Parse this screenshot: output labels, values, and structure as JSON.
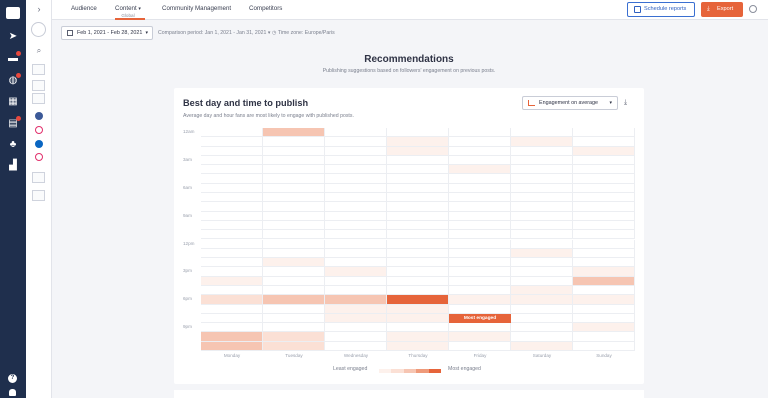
{
  "topnav": {
    "tabs": [
      {
        "label": "Audience"
      },
      {
        "label": "Content",
        "sub": "Global"
      },
      {
        "label": "Community Management"
      },
      {
        "label": "Competitors"
      }
    ],
    "schedule_label": "Schedule reports",
    "export_label": "Export"
  },
  "filters": {
    "date_range": "Feb 1, 2021 - Feb 28, 2021",
    "comparison": "Comparison period: Jan 1, 2021 - Jan 31, 2021",
    "timezone": "Time zone: Europe/Paris"
  },
  "header": {
    "title": "Recommendations",
    "subtitle": "Publishing suggestions based on followers' engagement on previous posts."
  },
  "card": {
    "title": "Best day and time to publish",
    "description": "Average day and hour fans are most likely to engage with published posts.",
    "select_label": "Engagement on average"
  },
  "heatmap": {
    "days": [
      "Monday",
      "Tuesday",
      "Wednesday",
      "Thursday",
      "Friday",
      "Saturday",
      "Sunday"
    ],
    "hour_labels": [
      "12am",
      "3am",
      "6am",
      "9am",
      "12pm",
      "3pm",
      "6pm",
      "9pm"
    ],
    "callout": "Most engaged",
    "legend_low": "Least engaged",
    "legend_high": "Most engaged",
    "colors": {
      "l1": "#fdf1ec",
      "l2": "#fbe0d5",
      "l3": "#f6c5b2",
      "l4": "#ef9a7a",
      "l5": "#e6643a"
    },
    "levels": [
      [
        0,
        3,
        0,
        0,
        0,
        0,
        0
      ],
      [
        0,
        0,
        0,
        1,
        0,
        1,
        0
      ],
      [
        0,
        0,
        0,
        1,
        0,
        0,
        1
      ],
      [
        0,
        0,
        0,
        0,
        0,
        0,
        0
      ],
      [
        0,
        0,
        0,
        0,
        1,
        0,
        0
      ],
      [
        0,
        0,
        0,
        0,
        0,
        0,
        0
      ],
      [
        0,
        0,
        0,
        0,
        0,
        0,
        0
      ],
      [
        0,
        0,
        0,
        0,
        0,
        0,
        0
      ],
      [
        0,
        0,
        0,
        0,
        0,
        0,
        0
      ],
      [
        0,
        0,
        0,
        0,
        0,
        0,
        0
      ],
      [
        0,
        0,
        0,
        0,
        0,
        0,
        0
      ],
      [
        0,
        0,
        0,
        0,
        0,
        0,
        0
      ],
      [
        0,
        0,
        0,
        0,
        0,
        0,
        0
      ],
      [
        0,
        0,
        0,
        0,
        0,
        1,
        0
      ],
      [
        0,
        1,
        0,
        0,
        0,
        0,
        0
      ],
      [
        0,
        0,
        1,
        0,
        0,
        0,
        1
      ],
      [
        1,
        0,
        0,
        0,
        0,
        0,
        3
      ],
      [
        0,
        0,
        0,
        0,
        0,
        1,
        0
      ],
      [
        2,
        3,
        3,
        5,
        1,
        1,
        1
      ],
      [
        0,
        0,
        1,
        1,
        0,
        0,
        0
      ],
      [
        0,
        0,
        1,
        1,
        5,
        0,
        0
      ],
      [
        0,
        0,
        0,
        0,
        0,
        0,
        1
      ],
      [
        3,
        2,
        0,
        1,
        1,
        0,
        0
      ],
      [
        3,
        2,
        0,
        1,
        0,
        1,
        0
      ]
    ],
    "callout_row": 20,
    "callout_day": 4
  }
}
